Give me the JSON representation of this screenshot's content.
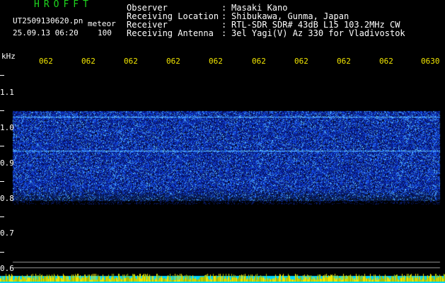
{
  "header": {
    "app_title": "HROFFT",
    "file_name": "UT2509130620.pn",
    "mode": "meteor",
    "datetime": "25.09.13 06:20",
    "count": "100"
  },
  "info": [
    {
      "key": "Observer",
      "value": "Masaki Kano"
    },
    {
      "key": "Receiving Location",
      "value": "Shibukawa, Gunma, Japan"
    },
    {
      "key": "Receiver",
      "value": "RTL-SDR SDR# 43dB L15 103.2MHz CW"
    },
    {
      "key": "Receiving Antenna",
      "value": "3el Yagi(V) Az 330 for Vladivostok"
    }
  ],
  "info_separator": ":",
  "spectrogram": {
    "unit": "kHz",
    "time_ticks": [
      "062",
      "062",
      "062",
      "062",
      "062",
      "062",
      "062",
      "062",
      "062",
      "0630"
    ],
    "freq_ticks": [
      "1.1",
      "1.0",
      "0.9",
      "0.8",
      "0.7",
      "0.6"
    ],
    "freq_range": [
      0.6,
      1.12
    ],
    "signal_band": [
      0.78,
      1.015
    ],
    "carrier_lines": [
      1.0,
      0.91
    ],
    "colors": {
      "text": "#ffffff",
      "time_ticks": "#f2e600",
      "title": "#1fd61f",
      "noise_low": "#0a1e9c",
      "noise_high": "#5ab4ff",
      "bottom_bar": "#00d8ff",
      "bottom_spikes": "#f2e600"
    }
  }
}
